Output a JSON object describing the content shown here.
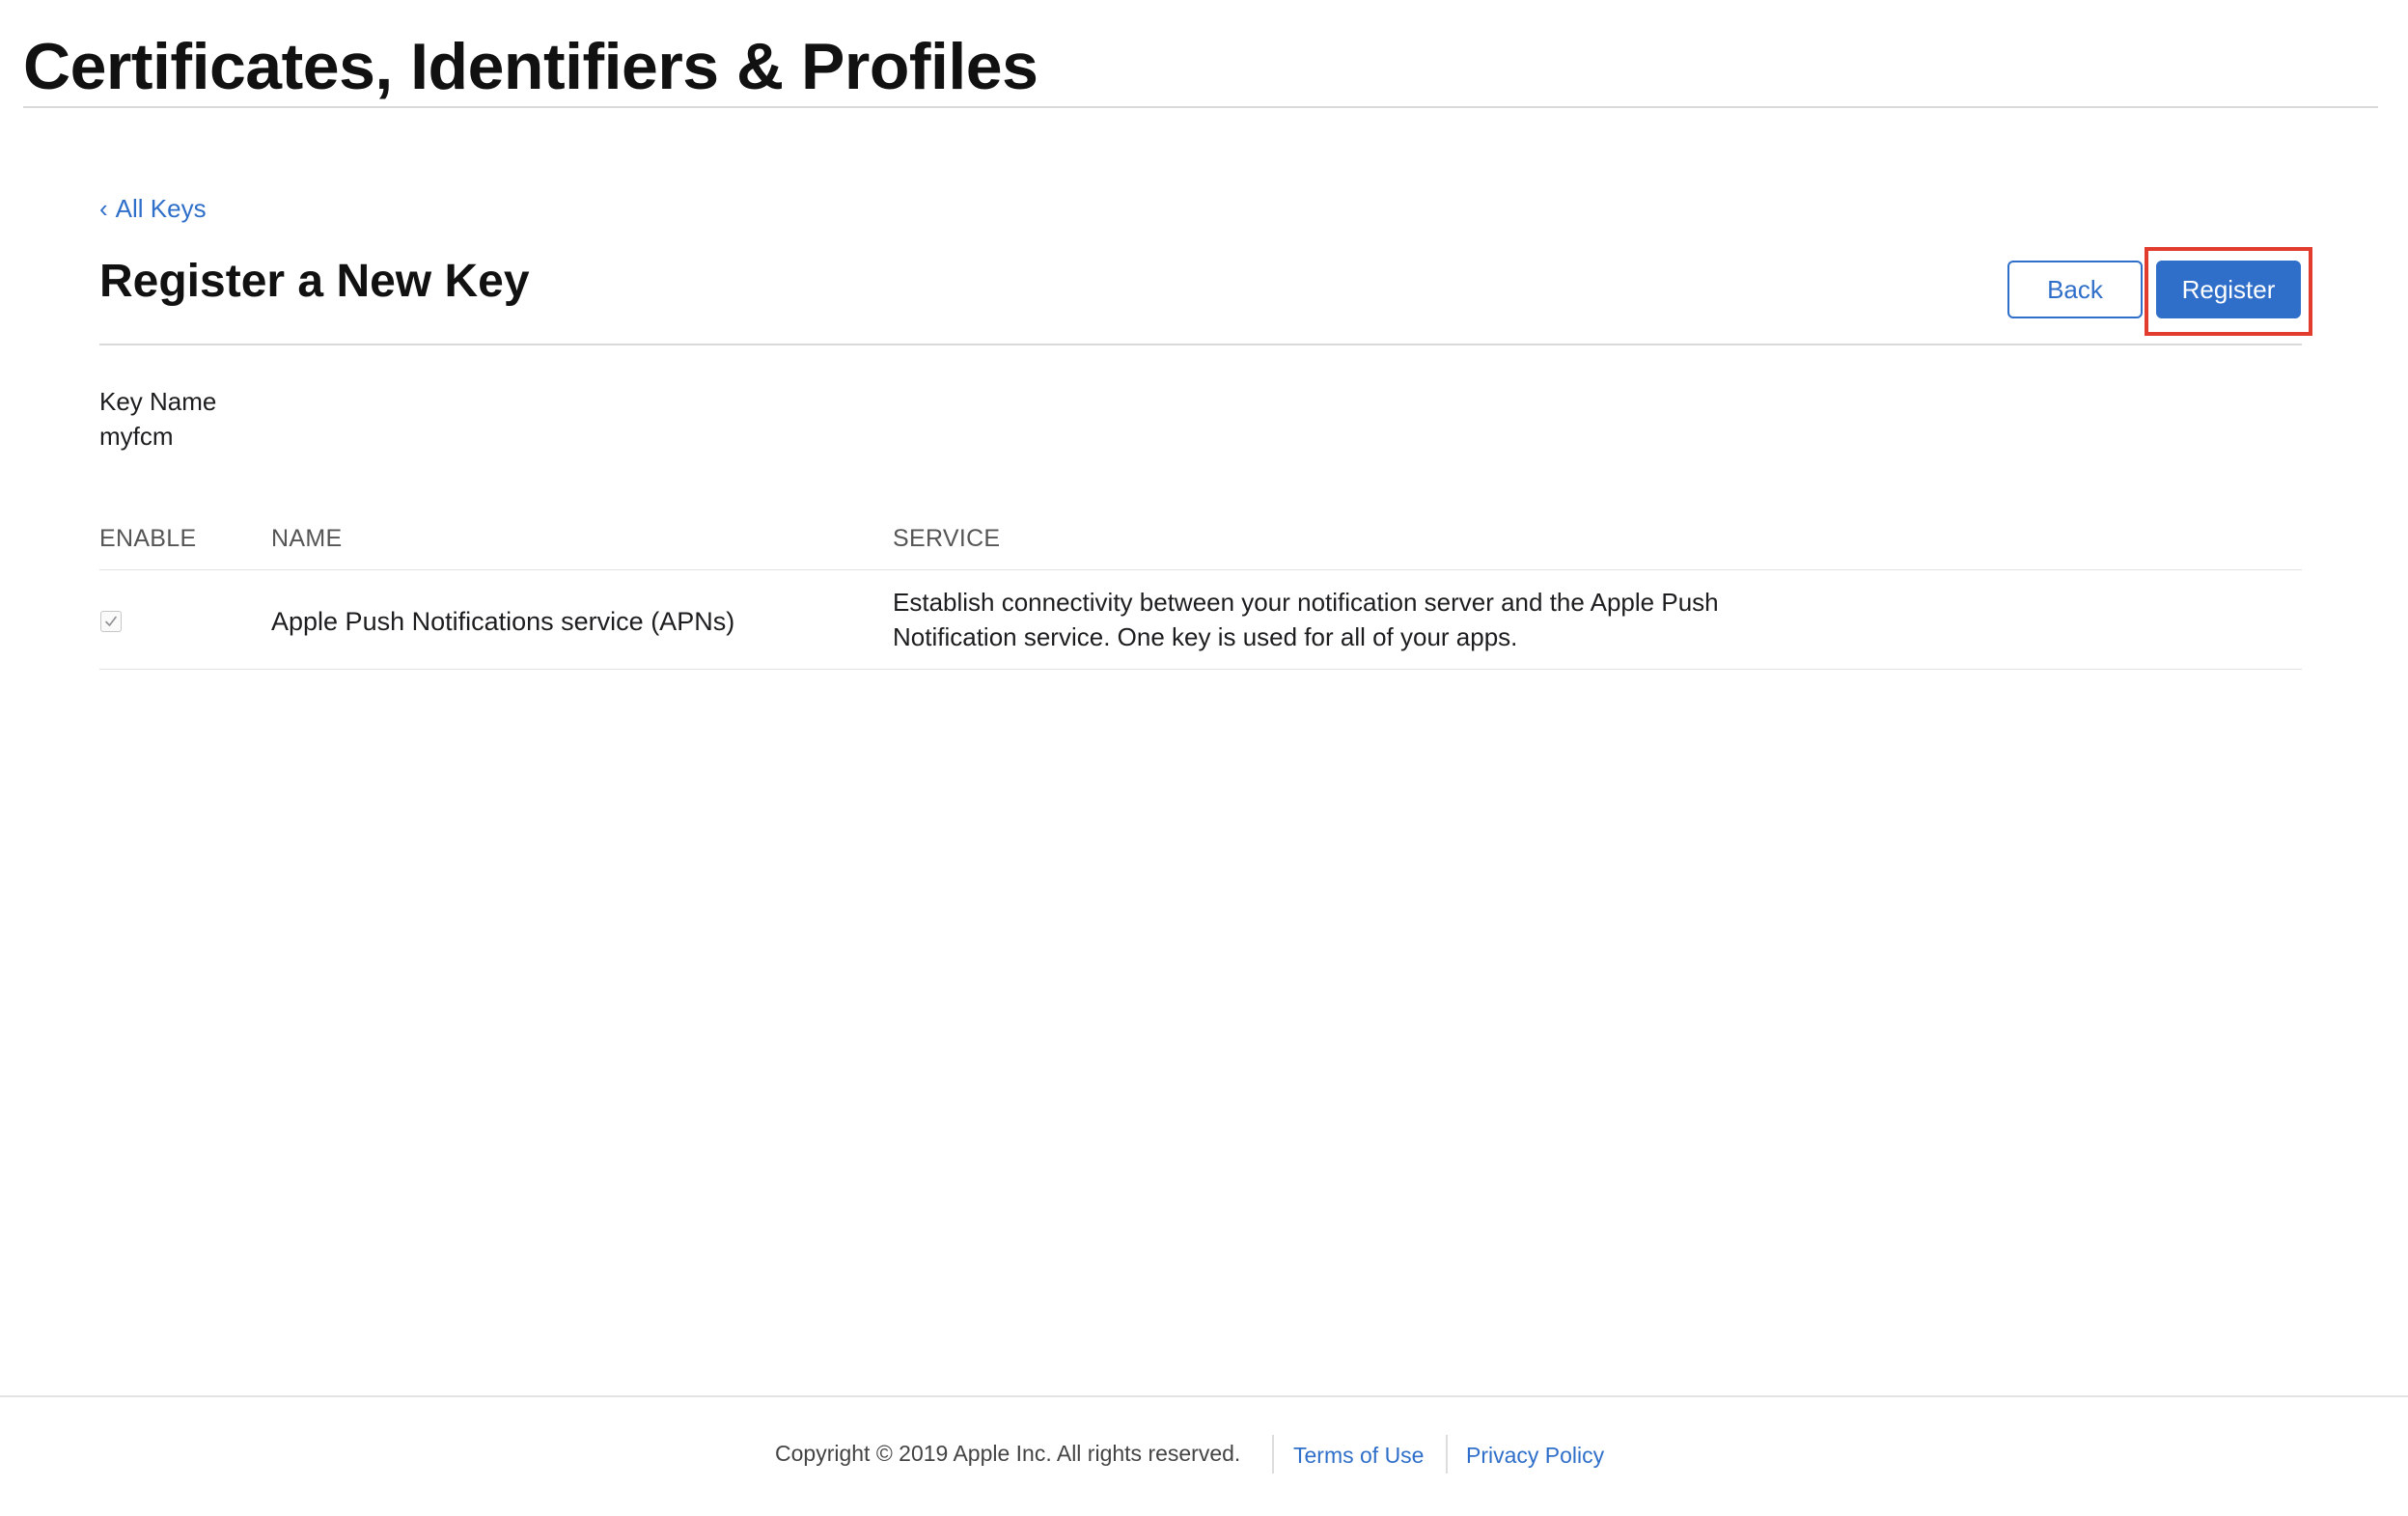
{
  "header": {
    "title": "Certificates, Identifiers & Profiles"
  },
  "breadcrumb": {
    "chevron": "‹",
    "label": "All Keys"
  },
  "page": {
    "heading": "Register a New Key"
  },
  "actions": {
    "back_label": "Back",
    "register_label": "Register",
    "highlight_color": "#e23c2f"
  },
  "key": {
    "label": "Key Name",
    "value": "myfcm"
  },
  "table": {
    "columns": [
      "ENABLE",
      "NAME",
      "SERVICE"
    ],
    "rows": [
      {
        "enabled": true,
        "name": "Apple Push Notifications service (APNs)",
        "service": "Establish connectivity between your notification server and the Apple Push Notification service. One key is used for all of your apps."
      }
    ]
  },
  "footer": {
    "copyright": "Copyright © 2019 Apple Inc. All rights reserved.",
    "terms_label": "Terms of Use",
    "privacy_label": "Privacy Policy"
  },
  "colors": {
    "accent": "#2f6fc9",
    "text": "#1d1d1f"
  },
  "icons": {
    "checkbox": "checkmark-icon",
    "breadcrumb": "chevron-left-icon"
  }
}
